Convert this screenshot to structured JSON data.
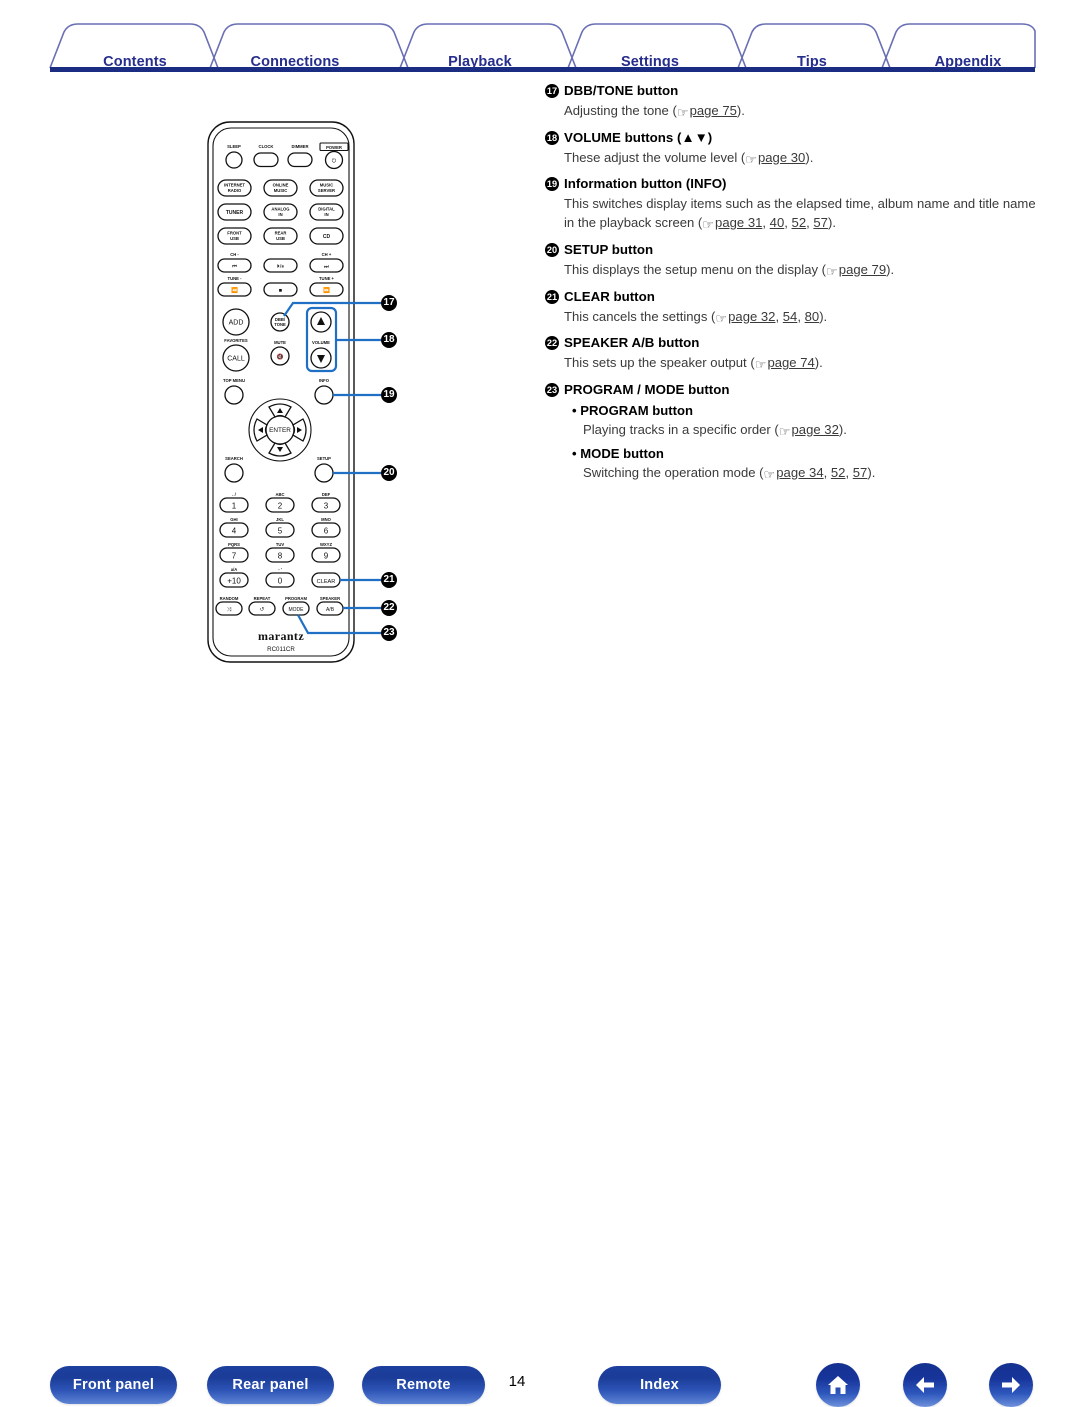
{
  "header": {
    "tabs": [
      {
        "label": "Contents"
      },
      {
        "label": "Connections"
      },
      {
        "label": "Playback"
      },
      {
        "label": "Settings"
      },
      {
        "label": "Tips"
      },
      {
        "label": "Appendix"
      }
    ],
    "accent_color": "#262d8c",
    "rule_color": "#1b2c83"
  },
  "entries": [
    {
      "num": "17",
      "title": "DBB/TONE button",
      "body_pre": "Adjusting the tone (",
      "pages": [
        "page 75"
      ],
      "body_post": ")."
    },
    {
      "num": "18",
      "title": "VOLUME buttons (▲▼)",
      "body_pre": "These adjust the volume level (",
      "pages": [
        "page 30"
      ],
      "body_post": ")."
    },
    {
      "num": "19",
      "title": "Information button (INFO)",
      "body_pre": "This switches display items such as the elapsed time, album name and title name in the playback screen (",
      "pages": [
        "page 31",
        "40",
        "52",
        "57"
      ],
      "body_post": ")."
    },
    {
      "num": "20",
      "title": "SETUP button",
      "body_pre": "This displays the setup menu on the display (",
      "pages": [
        "page 79"
      ],
      "body_post": ")."
    },
    {
      "num": "21",
      "title": "CLEAR button",
      "body_pre": "This cancels the settings (",
      "pages": [
        "page 32",
        "54",
        "80"
      ],
      "body_post": ")."
    },
    {
      "num": "22",
      "title": "SPEAKER A/B button",
      "body_pre": "This sets up the speaker output (",
      "pages": [
        "page 74"
      ],
      "body_post": ")."
    },
    {
      "num": "23",
      "title": "PROGRAM / MODE button",
      "subs": [
        {
          "title": "PROGRAM button",
          "body_pre": "Playing tracks in a specific order (",
          "pages": [
            "page 32"
          ],
          "body_post": ")."
        },
        {
          "title": "MODE button",
          "body_pre": "Switching the operation mode (",
          "pages": [
            "page 34",
            "52",
            "57"
          ],
          "body_post": ")."
        }
      ]
    }
  ],
  "remote": {
    "brand": "marantz",
    "model": "RC011CR",
    "top_row": [
      "SLEEP",
      "CLOCK",
      "DIMMER",
      "POWER"
    ],
    "sources": [
      [
        "INTERNET",
        "RADIO"
      ],
      [
        "ONLINE",
        "MUSIC"
      ],
      [
        "MUSIC",
        "SERVER"
      ],
      [
        "TUNER",
        ""
      ],
      [
        "ANALOG",
        "IN"
      ],
      [
        "DIGITAL",
        "IN"
      ],
      [
        "FRONT",
        "USB"
      ],
      [
        "REAR",
        "USB"
      ],
      [
        "CD",
        ""
      ]
    ],
    "transport_labels": {
      "ch_minus": "CH -",
      "ch_plus": "CH +",
      "tune_minus": "TUNE -",
      "tune_plus": "TUNE +"
    },
    "mid_labels": {
      "add": "ADD",
      "call": "CALL",
      "favorites": "FAVORITES",
      "dbb": "DBB/",
      "tone": "TONE",
      "mute": "MUTE",
      "volume": "VOLUME"
    },
    "nav_labels": {
      "top_menu": "TOP MENU",
      "info": "INFO",
      "search": "SEARCH",
      "setup": "SETUP",
      "enter": "ENTER"
    },
    "keypad": [
      {
        "key": "1",
        "sub": ". /"
      },
      {
        "key": "2",
        "sub": "ABC"
      },
      {
        "key": "3",
        "sub": "DEF"
      },
      {
        "key": "4",
        "sub": "GHI"
      },
      {
        "key": "5",
        "sub": "JKL"
      },
      {
        "key": "6",
        "sub": "MNO"
      },
      {
        "key": "7",
        "sub": "PQRS"
      },
      {
        "key": "8",
        "sub": "TUV"
      },
      {
        "key": "9",
        "sub": "WXYZ"
      },
      {
        "key": "+10",
        "sub": "a/A"
      },
      {
        "key": "0",
        "sub": "- '"
      },
      {
        "key": "CLEAR",
        "sub": ""
      }
    ],
    "bottom_row": [
      {
        "label": "RANDOM",
        "key": "⤨"
      },
      {
        "label": "REPEAT",
        "key": "↺"
      },
      {
        "label": "PROGRAM",
        "key": "MODE"
      },
      {
        "label": "SPEAKER",
        "key": "A/B"
      }
    ],
    "callouts": [
      "17",
      "18",
      "19",
      "20",
      "21",
      "22",
      "23"
    ]
  },
  "footer": {
    "buttons": [
      {
        "label": "Front panel"
      },
      {
        "label": "Rear panel"
      },
      {
        "label": "Remote"
      },
      {
        "label": "Index"
      }
    ],
    "page_number": "14",
    "icons": [
      {
        "name": "home-icon"
      },
      {
        "name": "back-arrow-icon"
      },
      {
        "name": "forward-arrow-icon"
      }
    ],
    "button_color": "#1d3f9e"
  }
}
